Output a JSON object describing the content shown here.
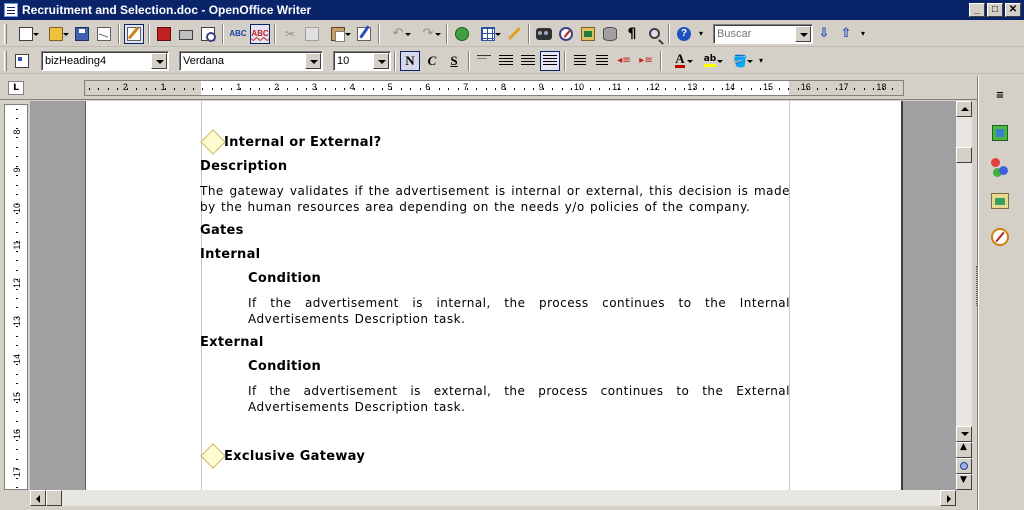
{
  "window": {
    "title": "Recruitment and Selection.doc - OpenOffice Writer",
    "minimize_icon": "minimize-icon",
    "maximize_icon": "maximize-icon",
    "close_icon": "close-icon"
  },
  "toolbar_standard": {
    "find_placeholder": "Buscar"
  },
  "toolbar_formatting": {
    "paragraph_style": "bizHeading4",
    "font_name": "Verdana",
    "font_size": "10"
  },
  "ruler_h": {
    "labels": [
      "2",
      "1",
      "1",
      "2",
      "3",
      "4",
      "5",
      "6",
      "7",
      "8",
      "9",
      "10",
      "11",
      "12",
      "13",
      "14",
      "15",
      "16",
      "17",
      "18"
    ]
  },
  "ruler_v": {
    "labels": [
      "8",
      "9",
      "10",
      "11",
      "12",
      "13",
      "14",
      "15",
      "16",
      "17"
    ]
  },
  "corner_tab": "L",
  "document": {
    "gateway1_title": "Internal or External?",
    "description_heading": "Description",
    "description_text": "The gateway validates if the advertisement is internal or external, this decision is made by the human resources area depending on the needs y/o policies of the company.",
    "gates_heading": "Gates",
    "internal_heading": "Internal",
    "internal_condition_heading": "Condition",
    "internal_condition_text": "If the advertisement is internal, the process continues to the Internal Advertisements Description task.",
    "external_heading": "External",
    "external_condition_heading": "Condition",
    "external_condition_text": "If the advertisement is external, the process continues to the External Advertisements Description task.",
    "gateway2_title": "Exclusive Gateway"
  },
  "colors": {
    "titlebar": "#0a246a",
    "chrome": "#d4d0c8",
    "gateway_fill": "#fffbd0"
  }
}
